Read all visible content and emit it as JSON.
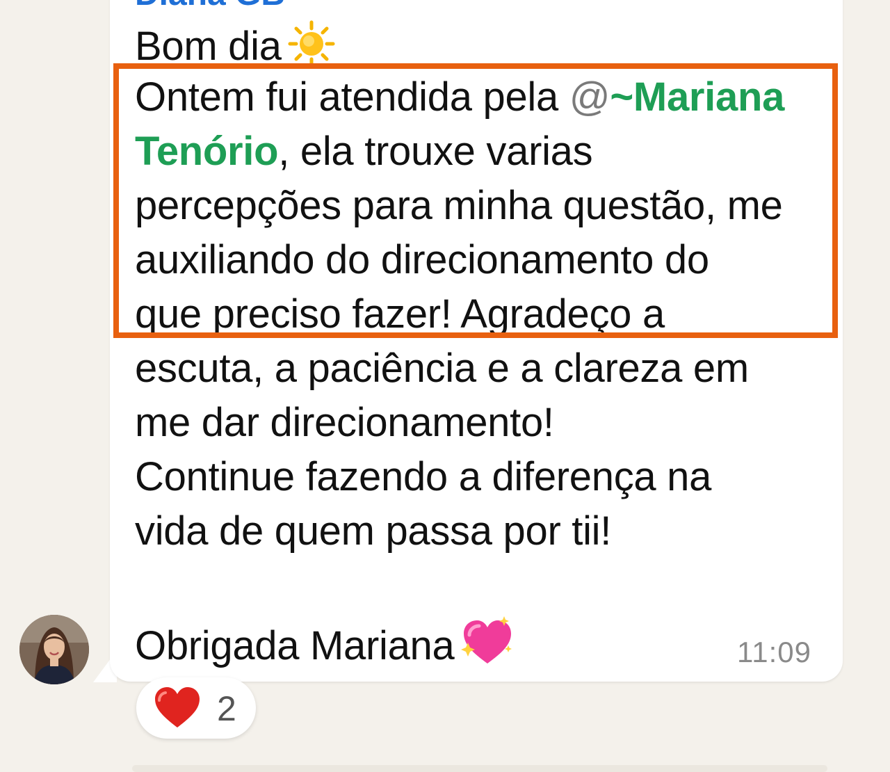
{
  "message": {
    "sender_name": "Diana GB",
    "greeting": "Bom dia",
    "greeting_emoji": "sun",
    "lines": {
      "line1_before_mention": "Ontem fui atendida pela ",
      "mention_at": "@",
      "mention_name_part1": "~Mariana",
      "mention_name_part2": "Tenório",
      "line2_after_mention": ", ela trouxe varias",
      "line3": "percepções para minha questão, me",
      "line4": "auxiliando do direcionamento do",
      "line5": "que preciso fazer! Agradeço a",
      "line6": "escuta, a paciência e a clareza em",
      "line7": "me dar direcionamento!",
      "line8": "Continue fazendo a diferença na",
      "line9": "vida de quem passa por tii!",
      "closing": "Obrigada Mariana"
    },
    "closing_emoji": "sparkling-heart",
    "timestamp": "11:09"
  },
  "reaction": {
    "emoji": "red-heart",
    "count": "2"
  },
  "colors": {
    "highlight_border": "#e8600f",
    "mention": "#1e9e55",
    "sender_name": "#1f6fd6",
    "background": "#f4f1eb"
  }
}
